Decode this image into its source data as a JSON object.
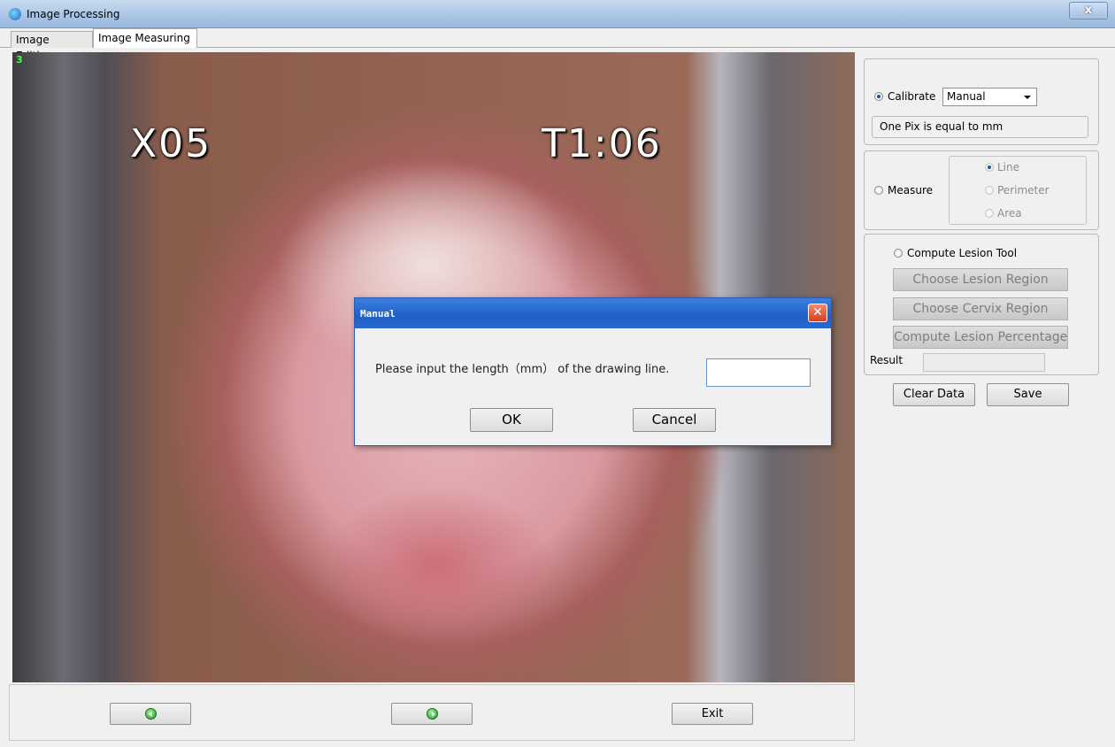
{
  "window": {
    "title": "Image Processing",
    "close_glyph": "x"
  },
  "tabs": [
    {
      "label": "Image Editing"
    },
    {
      "label": "Image Measuring"
    }
  ],
  "image": {
    "frame_number": "3",
    "zoom_text": "X05",
    "time_text": "T1:06"
  },
  "nav": {
    "prev_icon": "left-arrow-icon",
    "next_icon": "right-arrow-icon",
    "exit_label": "Exit"
  },
  "calibrate": {
    "label": "Calibrate",
    "selected": true,
    "mode_value": "Manual",
    "info": "One Pix is equal to  mm"
  },
  "measure": {
    "label": "Measure",
    "options": [
      "Line",
      "Perimeter",
      "Area"
    ]
  },
  "lesion": {
    "label": "Compute Lesion Tool",
    "buttons": [
      "Choose Lesion Region",
      "Choose Cervix Region",
      "Compute Lesion Percentage"
    ],
    "result_label": "Result"
  },
  "actions": {
    "clear_label": "Clear Data",
    "save_label": "Save"
  },
  "dialog": {
    "title": "Manual",
    "message": "Please input the length（mm） of the drawing line.",
    "ok_label": "OK",
    "cancel_label": "Cancel",
    "close_glyph": "✕"
  }
}
